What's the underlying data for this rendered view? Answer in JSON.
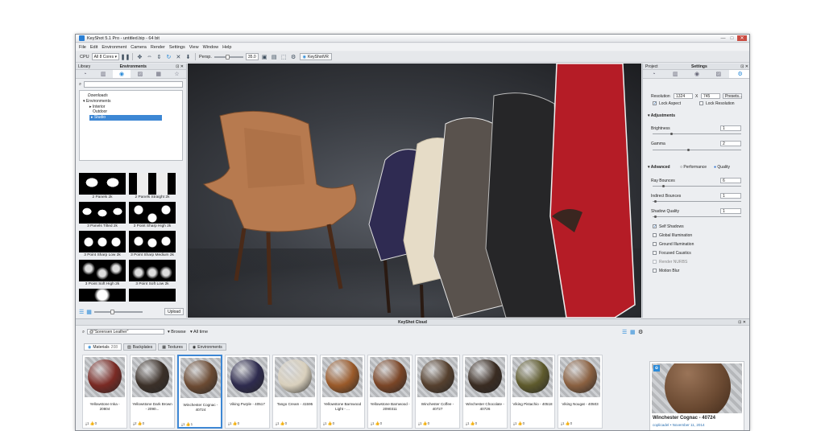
{
  "window": {
    "title": "KeyShot 5.1 Pro - untitled.bip - 64 bit",
    "controls": [
      "—",
      "□",
      "✕"
    ]
  },
  "menu": [
    "File",
    "Edit",
    "Environment",
    "Camera",
    "Render",
    "Settings",
    "View",
    "Window",
    "Help"
  ],
  "toolbar": {
    "cpu_label": "CPU",
    "cores": "All 8 Cores",
    "persp": "Persp.",
    "fov": "35.0",
    "keyshotvr": "KeyShotVR"
  },
  "library": {
    "panel_title": "Library",
    "tab_title": "Environments",
    "tree": {
      "root_label": "Downloads",
      "parent": "Environments",
      "children": [
        "Interior",
        "Outdoor",
        "Studio"
      ]
    },
    "thumbs": [
      "2 Panels 2k",
      "2 Panels Straight 2k",
      "3 Panels Tilted 2k",
      "3 Point Sharp High 2k",
      "3 Point Sharp Low 2k",
      "3 Point Sharp Medium 2k",
      "3 Point Soft High 2k",
      "3 Point Soft Low 2k"
    ],
    "upload": "Upload"
  },
  "settings": {
    "panel_project": "Project",
    "panel_title": "Settings",
    "resolution_label": "Resolution",
    "res_w": "1324",
    "res_x": "X",
    "res_h": "745",
    "presets": "Presets...",
    "lock_aspect": "Lock Aspect",
    "lock_resolution": "Lock Resolution",
    "adjustments": "Adjustments",
    "brightness_label": "Brightness",
    "brightness": "1",
    "gamma_label": "Gamma",
    "gamma": "2",
    "advanced": "Advanced",
    "performance": "Performance",
    "quality": "Quality",
    "ray_bounces_label": "Ray Bounces",
    "ray_bounces": "6",
    "indirect_label": "Indirect Bounces",
    "indirect": "1",
    "shadow_label": "Shadow Quality",
    "shadow": "1",
    "checks": [
      {
        "label": "Self Shadows",
        "checked": true
      },
      {
        "label": "Global Illumination",
        "checked": false
      },
      {
        "label": "Ground Illumination",
        "checked": false
      },
      {
        "label": "Focused Caustics",
        "checked": false
      },
      {
        "label": "Render NURBS",
        "checked": false
      },
      {
        "label": "Motion Blur",
        "checked": false
      }
    ]
  },
  "cloud": {
    "title": "KeyShot Cloud",
    "search": "@\"Sorensen Leather\"",
    "browse": "Browse",
    "all_time": "All time",
    "tabs": [
      {
        "label": "Materials",
        "count": "208"
      },
      {
        "label": "Backplates",
        "count": ""
      },
      {
        "label": "Textures",
        "count": ""
      },
      {
        "label": "Environments",
        "count": ""
      }
    ],
    "items": [
      {
        "name": "Yellowstone Inka - 20804",
        "likes": "1",
        "saves": "0",
        "color": "#7a2a24"
      },
      {
        "name": "Yellowstone Dark Brown - 2090...",
        "likes": "2",
        "saves": "0",
        "color": "#3b3028"
      },
      {
        "name": "Winchester Cognac - 40724",
        "likes": "1",
        "saves": "1",
        "color": "#6b4a32"
      },
      {
        "name": "Viking Purple - 40517",
        "likes": "1",
        "saves": "0",
        "color": "#2e2b4e"
      },
      {
        "name": "Tango Cream - 41595",
        "likes": "1",
        "saves": "0",
        "color": "#d9d0bd"
      },
      {
        "name": "Yellowstone Barnwood Light - ...",
        "likes": "1",
        "saves": "0",
        "color": "#9a5a2a"
      },
      {
        "name": "Yellowstone Barnwood - 2090311",
        "likes": "1",
        "saves": "0",
        "color": "#7a4526"
      },
      {
        "name": "Winchester Coffee - 40727",
        "likes": "1",
        "saves": "0",
        "color": "#55402e"
      },
      {
        "name": "Winchester Chocolate - 40726",
        "likes": "1",
        "saves": "0",
        "color": "#3a2c22"
      },
      {
        "name": "Viking Pistachio - 40518",
        "likes": "1",
        "saves": "0",
        "color": "#5e5a2c"
      },
      {
        "name": "Viking Nougat - 40503",
        "likes": "1",
        "saves": "0",
        "color": "#8a6040"
      }
    ],
    "preview": {
      "name": "Winchester Cognac - 40724",
      "meta": "coplicadel • November 11, 2014"
    }
  }
}
